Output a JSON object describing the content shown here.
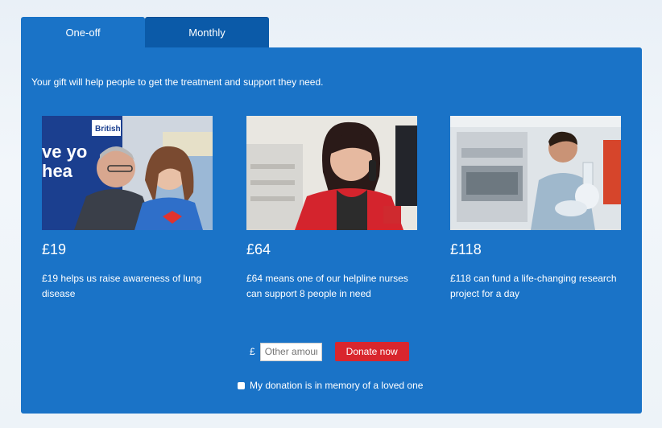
{
  "tabs": [
    {
      "label": "One-off",
      "active": true
    },
    {
      "label": "Monthly",
      "active": false
    }
  ],
  "intro": "Your gift will help people to get the treatment and support they need.",
  "options": [
    {
      "amount": "£19",
      "description": "£19 helps us raise awareness of lung disease",
      "image": "volunteers-photo"
    },
    {
      "amount": "£64",
      "description": "£64 means one of our helpline nurses can support 8 people in need",
      "image": "helpline-nurse-photo"
    },
    {
      "amount": "£118",
      "description": "£118 can fund a life-changing research project for a day",
      "image": "lab-researcher-photo"
    }
  ],
  "other_amount": {
    "currency": "£",
    "placeholder": "Other amount"
  },
  "donate_button": "Donate now",
  "memory_checkbox": {
    "label": "My donation is in memory of a loved one",
    "checked": false
  },
  "colors": {
    "panel": "#1a73c7",
    "tab_inactive": "#0b5aa8",
    "donate": "#d9262d"
  }
}
